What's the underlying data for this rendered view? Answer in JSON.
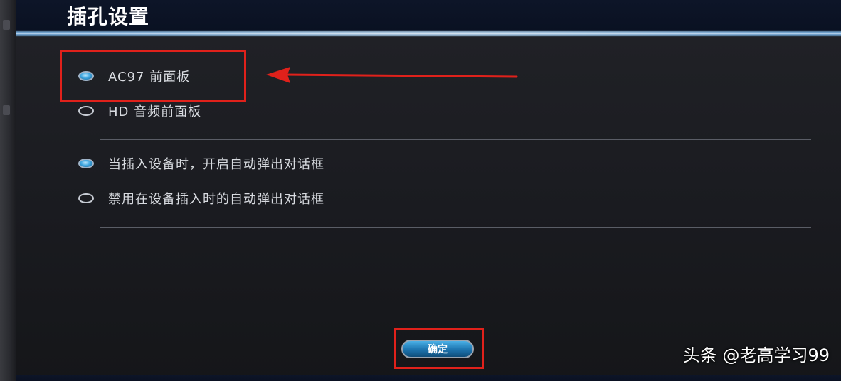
{
  "window": {
    "title": "插孔设置"
  },
  "panel_mode": {
    "options": [
      {
        "label": "AC97 前面板",
        "checked": true
      },
      {
        "label": "HD 音频前面板",
        "checked": false
      }
    ]
  },
  "autopopup": {
    "options": [
      {
        "label": "当插入设备时，开启自动弹出对话框",
        "checked": true
      },
      {
        "label": "禁用在设备插入时的自动弹出对话框",
        "checked": false
      }
    ]
  },
  "actions": {
    "ok_label": "确定"
  },
  "annotation": {
    "color": "#e0211b"
  },
  "watermark": {
    "text": "头条 @老高学习99"
  }
}
